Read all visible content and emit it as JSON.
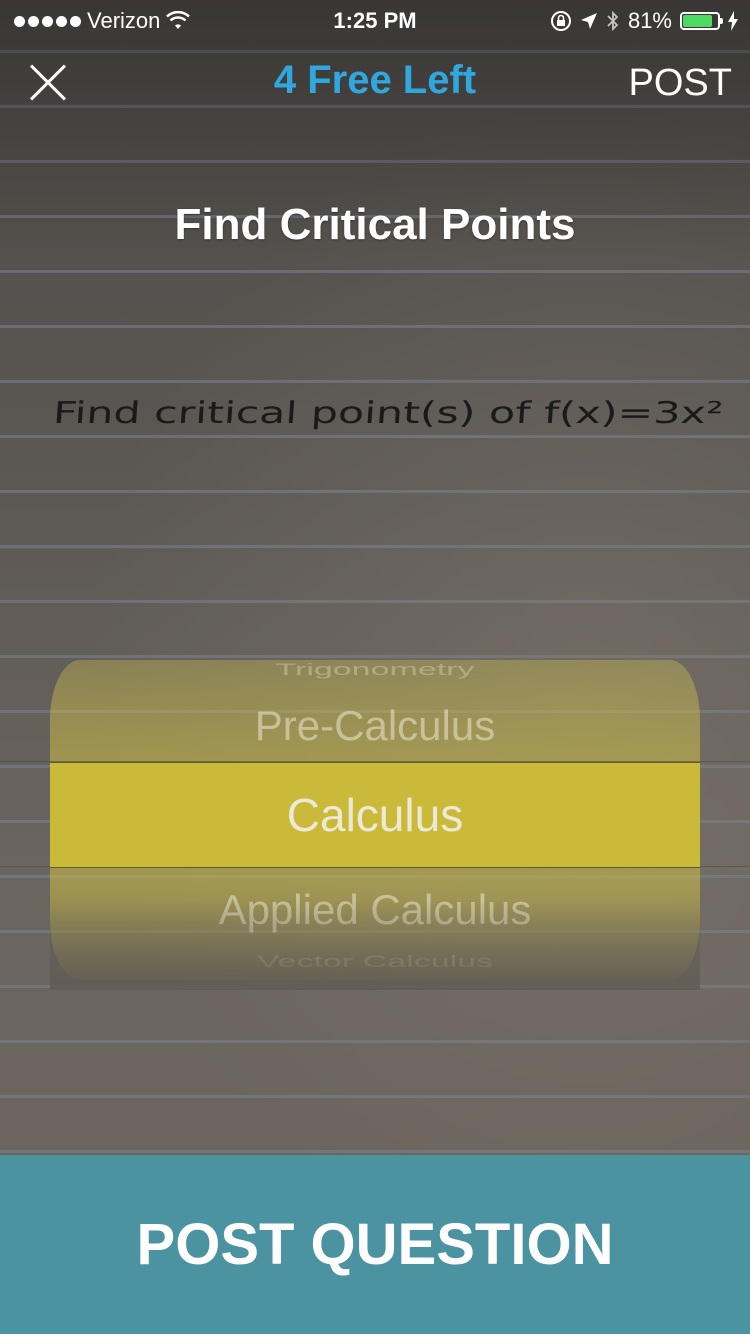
{
  "status_bar": {
    "carrier": "Verizon",
    "time": "1:25 PM",
    "battery": "81%",
    "battery_level": 0.81,
    "icons": [
      "signal-dots",
      "wifi-icon",
      "rotation-lock-icon",
      "location-icon",
      "bluetooth-icon",
      "battery-icon",
      "charging-icon"
    ]
  },
  "nav": {
    "close_icon": "close-icon",
    "title": "4 Free Left",
    "title_color": "#2fa8e0",
    "post_label": "POST"
  },
  "question": {
    "title": "Find Critical Points",
    "handwritten_text": "Find critical point(s) of f(x)=3x²"
  },
  "subject_picker": {
    "options": [
      "Trigonometry",
      "Pre-Calculus",
      "Calculus",
      "Applied Calculus",
      "Vector Calculus"
    ],
    "selected": "Calculus",
    "highlight_color": "#cbb93a"
  },
  "footer": {
    "post_question_label": "POST QUESTION",
    "color": "#4b93a0"
  }
}
